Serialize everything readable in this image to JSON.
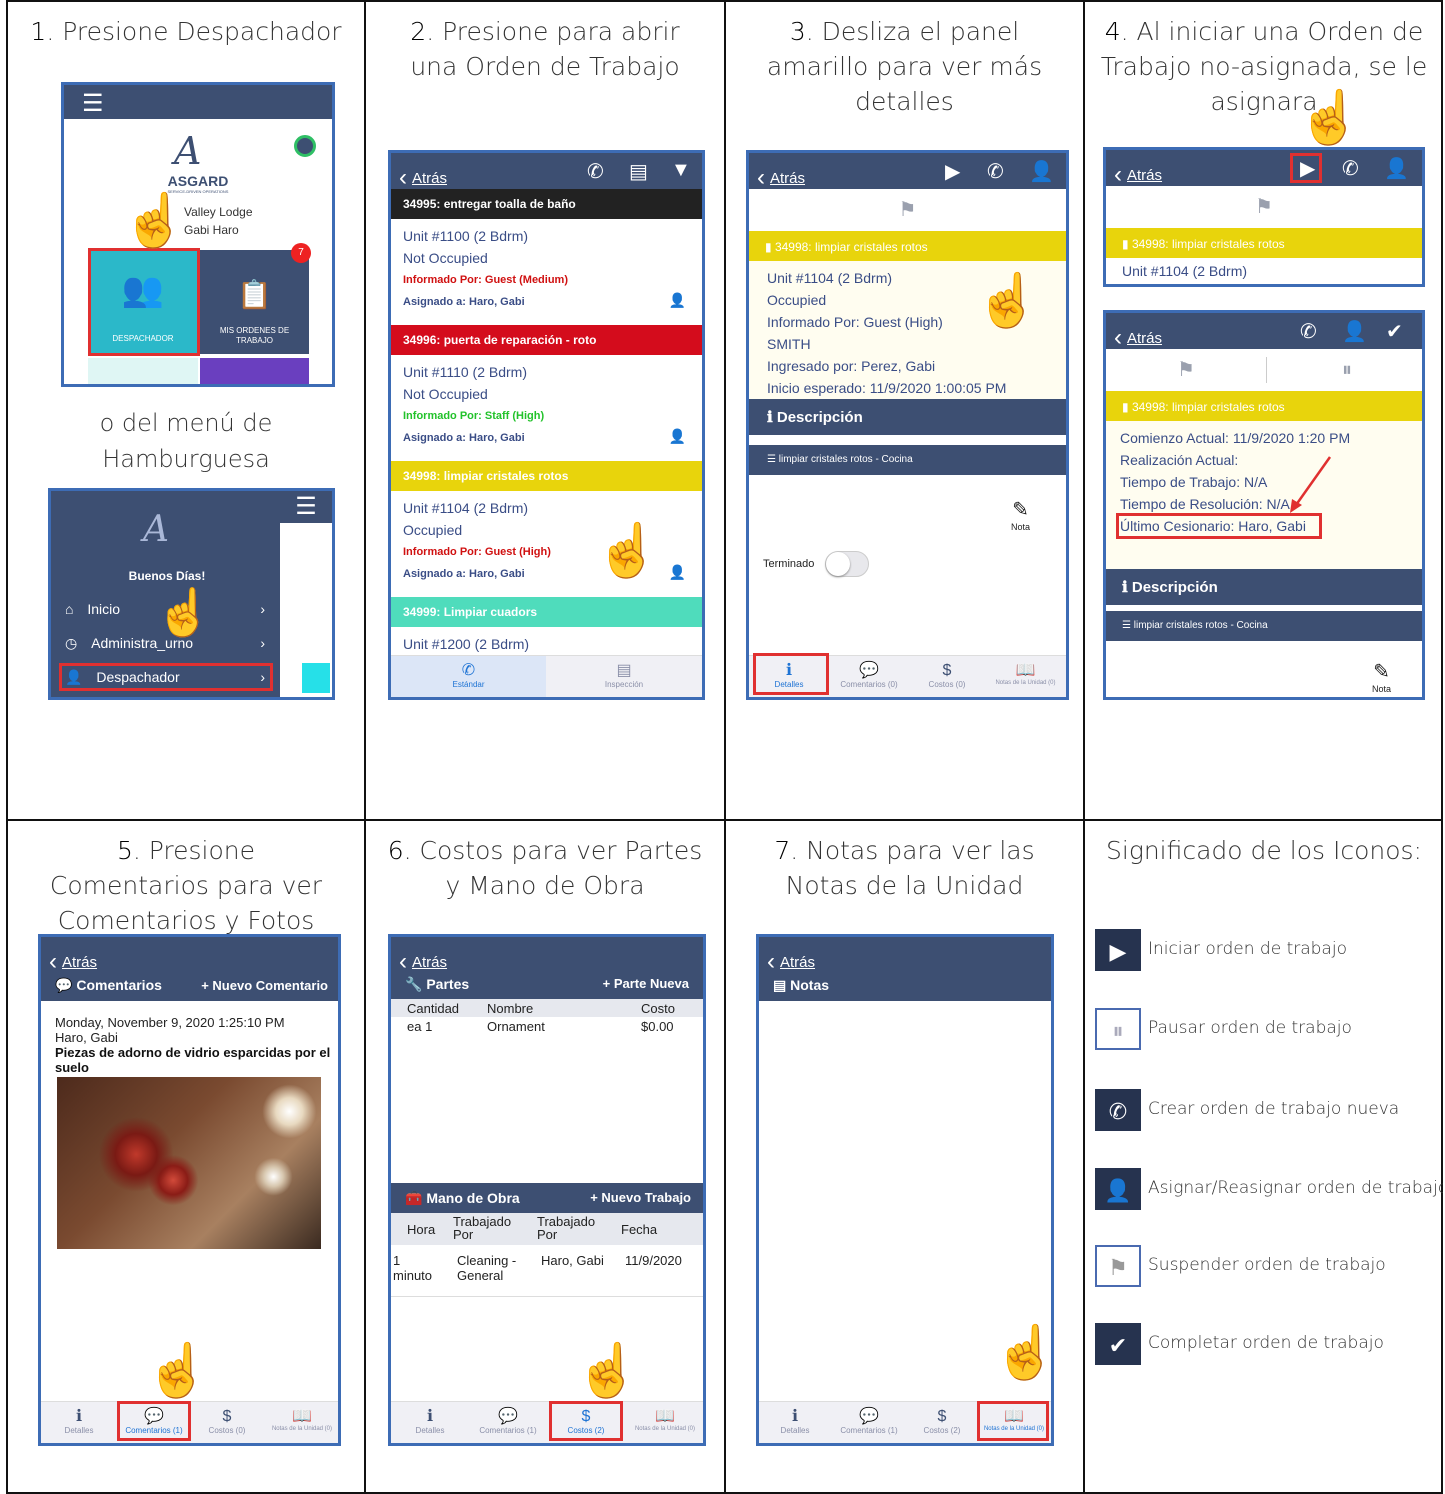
{
  "steps": [
    {
      "num": "1",
      "text": ". Presione Despachador"
    },
    {
      "num": "2",
      "text": ". Presione para abrir una Orden de Trabajo"
    },
    {
      "num": "3",
      "text": ". Desliza el panel amarillo para ver más detalles"
    },
    {
      "num": "4",
      "text": ". Al iniciar una Orden de Trabajo no-asignada, se le asignara"
    },
    {
      "num": "5",
      "text": ". Presione Comentarios para ver Comentarios y Fotos"
    },
    {
      "num": "6",
      "text": ". Costos para ver Partes y Mano de Obra"
    },
    {
      "num": "7",
      "text": ". Notas para ver las Notas de la Unidad"
    },
    {
      "num": "",
      "text": "Significado de los Iconos:"
    }
  ],
  "common": {
    "back": "Atrás",
    "tab_detalles": "Detalles",
    "tab_comentarios0": "Comentarios (0)",
    "tab_comentarios1": "Comentarios (1)",
    "tab_costos0": "Costos (0)",
    "tab_costos2": "Costos (2)",
    "tab_notas": "Notas de la Unidad (0)"
  },
  "s1": {
    "brand": "ASGARD",
    "brand_sub": "SERVICE-DRIVEN OPERATIONS",
    "property": "Valley Lodge",
    "user": "Gabi Haro",
    "badge": "7",
    "tile1": "DESPACHADOR",
    "tile2": "MIS ORDENES DE TRABAJO",
    "or_text": "o del menú de Hamburguesa",
    "greeting": "Buenos Días!",
    "menu": [
      "Inicio",
      "Administra_urno",
      "Despachador"
    ]
  },
  "s2": {
    "orders": [
      {
        "header": "34995: entregar toalla de baño",
        "color": "#222222",
        "text": "#ffffff",
        "unit": "Unit #1100 (2 Bdrm)",
        "occ": "Not Occupied",
        "inf": "Informado Por: Guest  (Medium)",
        "infcolor": "#d01010",
        "asig": "Asignado a: Haro, Gabi"
      },
      {
        "header": "34996: puerta de reparación - roto",
        "color": "#d40c1c",
        "text": "#ffffff",
        "unit": "Unit #1110 (2 Bdrm)",
        "occ": "Not Occupied",
        "inf": "Informado Por: Staff  (High)",
        "infcolor": "#22c22a",
        "asig": "Asignado a: Haro, Gabi"
      },
      {
        "header": "34998:  limpiar cristales rotos",
        "color": "#e8d40c",
        "text": "#ffffff",
        "unit": "Unit #1104 (2 Bdrm)",
        "occ": "Occupied",
        "inf": "Informado Por: Guest  (High)",
        "infcolor": "#d01010",
        "asig": "Asignado a: Haro, Gabi"
      },
      {
        "header": "34999:  Limpiar cuadors",
        "color": "#4fdcbc",
        "text": "#ffffff",
        "unit": "Unit #1200 (2 Bdrm)",
        "occ": "",
        "inf": "",
        "infcolor": "#d01010",
        "asig": ""
      }
    ],
    "tab_standard": "Estándar",
    "tab_inspection": "Inspección"
  },
  "s3": {
    "order": "34998:  limpiar cristales rotos",
    "lines": [
      "Unit #1104 (2 Bdrm)",
      "Occupied",
      "Informado Por: Guest  (High)",
      "SMITH",
      "Ingresado por: Perez, Gabi",
      "Inicio esperado: 11/9/2020 1:00:05 PM"
    ],
    "desc_title": "Descripción",
    "task": "limpiar cristales rotos - Cocina",
    "nota": "Nota",
    "terminado": "Terminado"
  },
  "s4": {
    "order": "34998:  limpiar cristales rotos",
    "unit": "Unit #1104 (2 Bdrm)",
    "lines": [
      "Comienzo Actual: 11/9/2020 1:20 PM",
      "Realización Actual:",
      "Tiempo de Trabajo: N/A",
      "Tiempo de Resolución: N/A",
      "Último Cesionario: Haro, Gabi"
    ],
    "desc_title": "Descripción",
    "task": "limpiar cristales rotos - Cocina",
    "nota": "Nota"
  },
  "s5": {
    "header": "Comentarios",
    "new_comment": "Nuevo Comentario",
    "date": "Monday, November 9, 2020 1:25:10 PM",
    "author": "Haro, Gabi",
    "comment": "Piezas de adorno de vidrio esparcidas por el suelo"
  },
  "s6": {
    "parts_title": "Partes",
    "new_part": "Parte Nueva",
    "parts_cols": [
      "Cantidad",
      "Nombre",
      "Costo"
    ],
    "parts_row": [
      "ea 1",
      "Ornament",
      "$0.00"
    ],
    "labor_title": "Mano de Obra",
    "new_labor": "Nuevo Trabajo",
    "labor_cols": [
      "Hora",
      "Trabajado Por",
      "Trabajado Por",
      "Fecha"
    ],
    "labor_row": [
      "1 minuto",
      "Cleaning - General",
      "Haro, Gabi",
      "11/9/2020"
    ]
  },
  "s7": {
    "title": "Notas"
  },
  "legend": [
    {
      "icon": "play-icon",
      "text": "Iniciar orden de trabajo"
    },
    {
      "icon": "pause-icon",
      "text": "Pausar orden de trabajo"
    },
    {
      "icon": "new-call-icon",
      "text": "Crear orden de trabajo nueva"
    },
    {
      "icon": "assign-user-icon",
      "text": "Asignar/Reasignar orden de trabajo"
    },
    {
      "icon": "flag-icon",
      "text": "Suspender orden de trabajo"
    },
    {
      "icon": "check-icon",
      "text": "Completar orden de trabajo"
    }
  ]
}
